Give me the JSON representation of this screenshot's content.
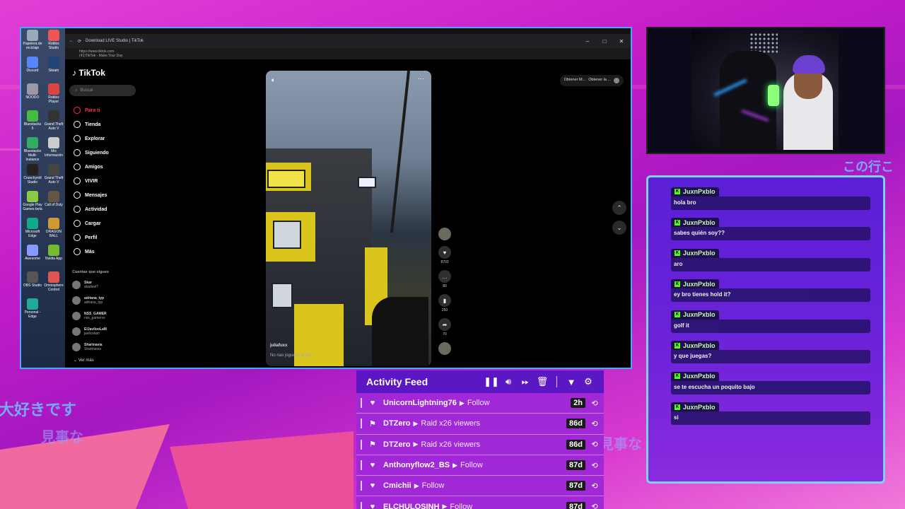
{
  "background": {
    "jp_left_1": "大好きです",
    "jp_left_2": "見事な",
    "jp_right_1": "見事な",
    "jp_top_right": "この行こ"
  },
  "browser": {
    "tab_title": "Download LIVE Studio | TikTok",
    "url": "https://www.tiktok.com",
    "tab_subtitle": "(41)TikTok - Make Your Day"
  },
  "desktop_icons": [
    "Papelera de reciclaje",
    "Roblox Studio",
    "Discord",
    "Steam",
    "NOODO",
    "Roblox Player",
    "Bluestacks 5",
    "Grand Theft Auto V",
    "Bluestacks Multi-Instance",
    "Mis Información",
    "Crunchyroll Studio",
    "Grand Theft Auto V",
    "Google Play Games beta",
    "Call of Duty",
    "Microsoft Edge",
    "DRAGON BALL",
    "Awesome",
    "Nvidia App",
    "OBS Studio",
    "Omnisphere Control",
    "Personal - Edge"
  ],
  "tiktok": {
    "logo": "TikTok",
    "search_placeholder": "Buscar",
    "nav": [
      {
        "label": "Para ti",
        "icon": "home-icon",
        "active": true
      },
      {
        "label": "Tienda",
        "icon": "shop-icon"
      },
      {
        "label": "Explorar",
        "icon": "compass-icon"
      },
      {
        "label": "Siguiendo",
        "icon": "following-icon"
      },
      {
        "label": "Amigos",
        "icon": "friends-icon"
      },
      {
        "label": "VIVIR",
        "icon": "live-icon"
      },
      {
        "label": "Mensajes",
        "icon": "messages-icon"
      },
      {
        "label": "Actividad",
        "icon": "activity-icon"
      },
      {
        "label": "Cargar",
        "icon": "upload-icon"
      },
      {
        "label": "Perfil",
        "icon": "profile-icon"
      },
      {
        "label": "Más",
        "icon": "more-icon"
      }
    ],
    "following_title": "Cuentas que sigues",
    "following": [
      {
        "name": "Skar",
        "handle": "skarleef7"
      },
      {
        "name": "adriana_typ",
        "handle": "adriana_typ"
      },
      {
        "name": "NSS_GAMER",
        "handle": "nss_gamervx"
      },
      {
        "name": "ElJavilooLaM",
        "handle": "javilcolam"
      },
      {
        "name": "Shartnavia",
        "handle": "Shartnavia"
      }
    ],
    "see_more": "Ver más",
    "top_buttons": [
      "Obtener M...",
      "Obtener la ..."
    ],
    "video": {
      "author": "juliafuxx",
      "caption": "No nao jogueim jeje@"
    },
    "actions": [
      {
        "icon": "heart-icon",
        "count": "8703"
      },
      {
        "icon": "comment-icon",
        "count": "80"
      },
      {
        "icon": "bookmark-icon",
        "count": "250"
      },
      {
        "icon": "share-icon",
        "count": "70"
      }
    ]
  },
  "chat": {
    "messages": [
      {
        "user": "JuxnPxblo",
        "text": "hola bro"
      },
      {
        "user": "JuxnPxblo",
        "text": "sabes quién soy??"
      },
      {
        "user": "JuxnPxblo",
        "text": "aro"
      },
      {
        "user": "JuxnPxblo",
        "text": "ey bro tienes hold it?"
      },
      {
        "user": "JuxnPxblo",
        "text": "golf it"
      },
      {
        "user": "JuxnPxblo",
        "text": "y que juegas?"
      },
      {
        "user": "JuxnPxblo",
        "text": "se te escucha un poquito bajo"
      },
      {
        "user": "JuxnPxblo",
        "text": "si"
      }
    ]
  },
  "feed": {
    "title": "Activity Feed",
    "rows": [
      {
        "icon": "heart-icon",
        "user": "UnicornLightning76",
        "event": "Follow",
        "age": "2h"
      },
      {
        "icon": "raid-icon",
        "user": "DTZero",
        "event": "Raid x26 viewers",
        "age": "86d"
      },
      {
        "icon": "raid-icon",
        "user": "DTZero",
        "event": "Raid x26 viewers",
        "age": "86d"
      },
      {
        "icon": "heart-icon",
        "user": "Anthonyflow2_BS",
        "event": "Follow",
        "age": "87d"
      },
      {
        "icon": "heart-icon",
        "user": "Cmichii",
        "event": "Follow",
        "age": "87d"
      },
      {
        "icon": "heart-icon",
        "user": "ELCHULOSINH",
        "event": "Follow",
        "age": "87d"
      }
    ]
  },
  "colors": {
    "accent_blue": "#7bd4ff",
    "feed_header": "#5b17c4",
    "chat_bg": "#5a1fd6",
    "kick_green": "#53fc18",
    "tiktok_red": "#ff2d55"
  }
}
